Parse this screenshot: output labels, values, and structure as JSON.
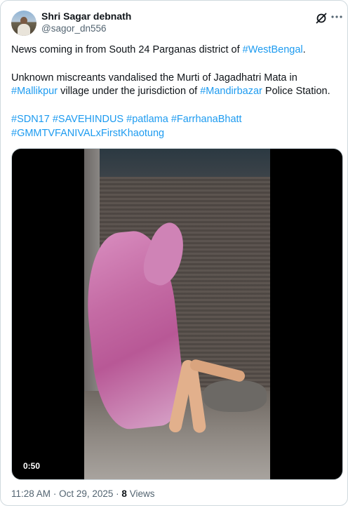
{
  "author": {
    "name": "Shri Sagar debnath",
    "handle": "@sagor_dn556"
  },
  "tweet": {
    "line1_prefix": "News coming in from South 24 Parganas district of ",
    "line1_tag": "#WestBengal",
    "line1_suffix": ".",
    "line2": "Unknown miscreants vandalised the Murti of Jagadhatri Mata in",
    "line3_tag1": "#Mallikpur",
    "line3_mid": " village under the jurisdiction of ",
    "line3_tag2": "#Mandirbazar",
    "line3_suffix": " Police Station.",
    "hashtags_line1": [
      "#SDN17",
      "#SAVEHINDUS",
      "#patlama",
      "#FarrhanaBhatt"
    ],
    "hashtags_line2": [
      "#GMMTVFANIVALxFirstKhaotung"
    ]
  },
  "video": {
    "duration": "0:50"
  },
  "meta": {
    "time": "11:28 AM",
    "separator": "·",
    "date": "Oct 29, 2025",
    "views_count": "8",
    "views_label": "Views"
  },
  "icons": {
    "grok": "grok-icon",
    "more": "more-options-icon"
  },
  "colors": {
    "link": "#1d9bf0",
    "secondary_text": "#536471",
    "primary_text": "#0f1419",
    "border": "#cfd9de"
  }
}
